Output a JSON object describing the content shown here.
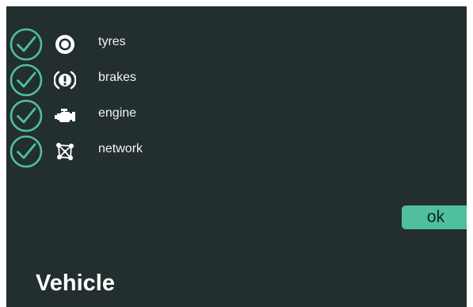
{
  "colors": {
    "background": "#232e2e",
    "check_accent": "#4fbf9f",
    "text": "#f2f4f4",
    "button_fill": "#4fbf9f"
  },
  "checklist": {
    "items": [
      {
        "label": "tyres",
        "icon": "tyre-icon",
        "checked": true
      },
      {
        "label": "brakes",
        "icon": "brake-warning-icon",
        "checked": true
      },
      {
        "label": "engine",
        "icon": "engine-icon",
        "checked": true
      },
      {
        "label": "network",
        "icon": "network-icon",
        "checked": true
      }
    ]
  },
  "ok_button": {
    "label": "ok"
  },
  "page": {
    "title": "Vehicle"
  }
}
